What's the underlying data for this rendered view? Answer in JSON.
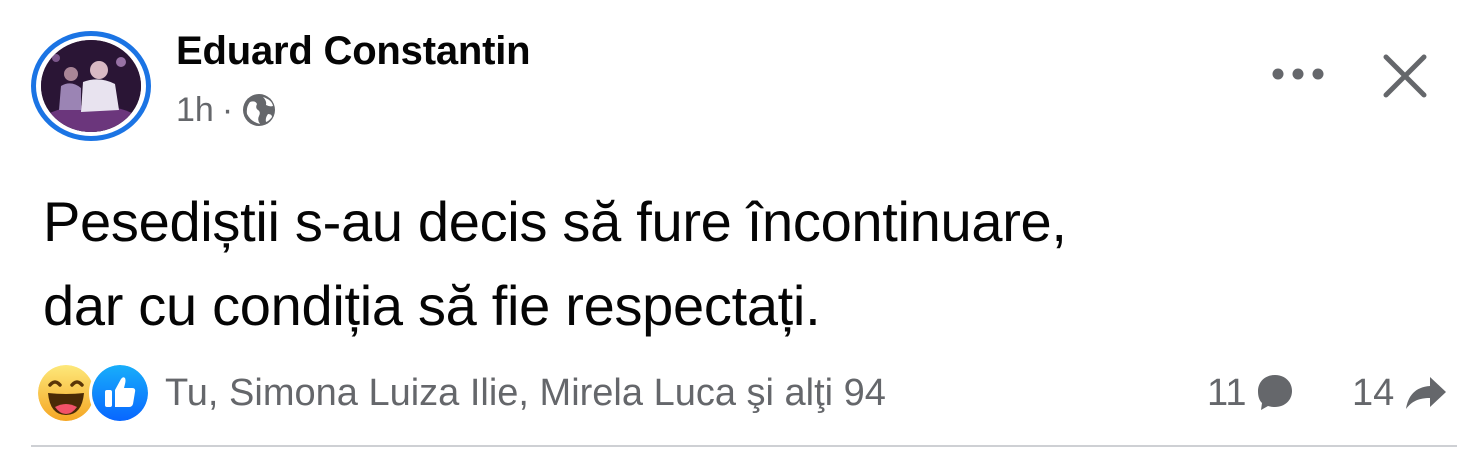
{
  "post": {
    "author": "Eduard Constantin",
    "time": "1h",
    "separator": "·",
    "visibility_icon": "globe-icon",
    "text_lines": [
      "Pesediștii s-au decis să fure încontinuare,",
      "dar cu condiția să fie respectați."
    ]
  },
  "header_actions": {
    "more_icon": "more-horizontal-icon",
    "close_icon": "close-icon"
  },
  "reactions": {
    "icons": [
      "haha-icon",
      "like-icon"
    ],
    "names": "Tu, Simona Luiza Ilie, Mirela Luca şi alţi 94",
    "comments_count": "11",
    "comments_icon": "comment-icon",
    "shares_count": "14",
    "shares_icon": "share-icon"
  },
  "colors": {
    "ring": "#1b74e4",
    "like_blue": "#1877f2",
    "haha_yellow": "#f7b928",
    "secondary_text": "#65676b",
    "divider": "#ced0d4"
  }
}
